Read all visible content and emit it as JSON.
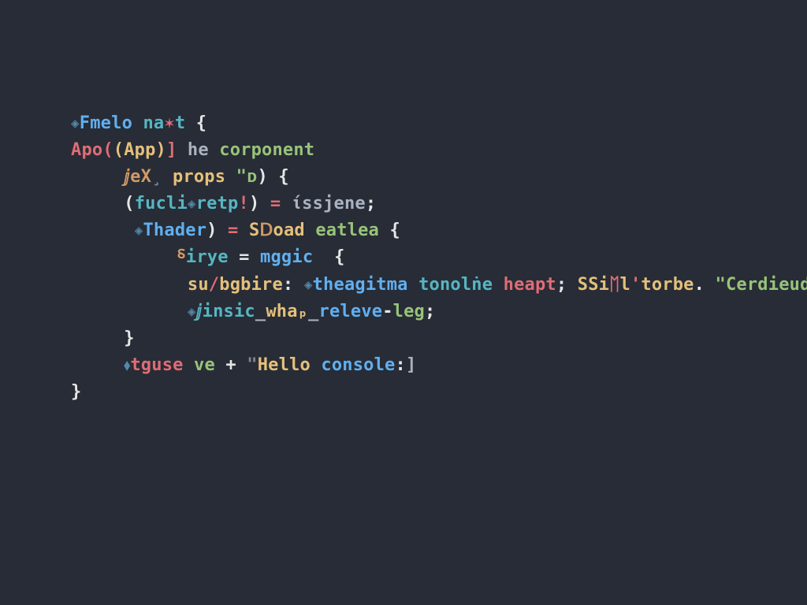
{
  "colors": {
    "background": "#272c36",
    "keyword": "#c678dd",
    "function": "#61afef",
    "string": "#98c379",
    "identifier": "#e5c07b",
    "red": "#e06c75",
    "cyan": "#56b6c2",
    "plain": "#abb2bf",
    "white": "#e6e6e6",
    "orange": "#d19a66"
  },
  "lines": [
    {
      "indent": 0,
      "tokens": [
        {
          "cls": "sym",
          "t": "◈"
        },
        {
          "cls": "fn",
          "t": "Fmelo "
        },
        {
          "cls": "cyan",
          "t": "na"
        },
        {
          "cls": "red",
          "t": "✶"
        },
        {
          "cls": "cyan",
          "t": "t "
        },
        {
          "cls": "white",
          "t": "{"
        }
      ]
    },
    {
      "indent": 0,
      "tokens": [
        {
          "cls": "red",
          "t": "Apo("
        },
        {
          "cls": "id",
          "t": "(App)"
        },
        {
          "cls": "red",
          "t": "]"
        },
        {
          "cls": "plain",
          "t": " he "
        },
        {
          "cls": "str",
          "t": "corponent"
        }
      ]
    },
    {
      "indent": 1,
      "tokens": [
        {
          "cls": "orange",
          "t": "ⅉeX"
        },
        {
          "cls": "dim",
          "t": "¸"
        },
        {
          "cls": "id",
          "t": " props "
        },
        {
          "cls": "str",
          "t": "\"ᴅ"
        },
        {
          "cls": "white",
          "t": ") {"
        }
      ]
    },
    {
      "indent": 1,
      "tokens": [
        {
          "cls": "white",
          "t": "("
        },
        {
          "cls": "cyan",
          "t": "fucli"
        },
        {
          "cls": "sym",
          "t": "◈"
        },
        {
          "cls": "cyan",
          "t": "retp"
        },
        {
          "cls": "red",
          "t": "!"
        },
        {
          "cls": "white",
          "t": ") "
        },
        {
          "cls": "red",
          "t": "= "
        },
        {
          "cls": "plain",
          "t": "ίssjene"
        },
        {
          "cls": "white",
          "t": ";"
        }
      ]
    },
    {
      "indent": 1,
      "tokens": [
        {
          "cls": "plain",
          "t": " "
        },
        {
          "cls": "sym",
          "t": "◈"
        },
        {
          "cls": "fn",
          "t": "Thader"
        },
        {
          "cls": "white",
          "t": ") "
        },
        {
          "cls": "red",
          "t": "= "
        },
        {
          "cls": "id",
          "t": "S"
        },
        {
          "cls": "orange",
          "t": "Ⅾ"
        },
        {
          "cls": "id",
          "t": "oad "
        },
        {
          "cls": "str",
          "t": "eatlea "
        },
        {
          "cls": "white",
          "t": "{"
        }
      ]
    },
    {
      "indent": 2,
      "tokens": [
        {
          "cls": "orange",
          "t": "⸹"
        },
        {
          "cls": "cyan",
          "t": "irye "
        },
        {
          "cls": "white",
          "t": "= "
        },
        {
          "cls": "fn",
          "t": "mggic"
        },
        {
          "cls": "white",
          "t": "  {"
        }
      ]
    },
    {
      "indent": 2,
      "tokens": [
        {
          "cls": "plain",
          "t": " "
        },
        {
          "cls": "id",
          "t": "su"
        },
        {
          "cls": "red",
          "t": "/"
        },
        {
          "cls": "id",
          "t": "bgbire"
        },
        {
          "cls": "white",
          "t": ": "
        },
        {
          "cls": "sym",
          "t": "◈"
        },
        {
          "cls": "fn",
          "t": "theagitma "
        },
        {
          "cls": "cyan",
          "t": "tonolṅe "
        },
        {
          "cls": "red",
          "t": "heapt"
        },
        {
          "cls": "white",
          "t": "; "
        },
        {
          "cls": "id",
          "t": "SSi"
        },
        {
          "cls": "red",
          "t": "ᛖ"
        },
        {
          "cls": "id",
          "t": "l"
        },
        {
          "cls": "red",
          "t": "'"
        },
        {
          "cls": "id",
          "t": "torbe"
        },
        {
          "cls": "white",
          "t": ". "
        },
        {
          "cls": "str",
          "t": "\"Cerdieuds,\""
        }
      ]
    },
    {
      "indent": 2,
      "tokens": [
        {
          "cls": "plain",
          "t": " "
        },
        {
          "cls": "sym",
          "t": "◈"
        },
        {
          "cls": "cyan",
          "t": "ⅉinsic"
        },
        {
          "cls": "plain",
          "t": "_"
        },
        {
          "cls": "id",
          "t": "whaₚ"
        },
        {
          "cls": "plain",
          "t": "_"
        },
        {
          "cls": "fn",
          "t": "releve"
        },
        {
          "cls": "white",
          "t": "-"
        },
        {
          "cls": "str",
          "t": "leg"
        },
        {
          "cls": "white",
          "t": ";"
        }
      ]
    },
    {
      "indent": 1,
      "tokens": [
        {
          "cls": "white",
          "t": "}"
        }
      ]
    },
    {
      "indent": 0,
      "tokens": [
        {
          "cls": "plain",
          "t": ""
        }
      ]
    },
    {
      "indent": 1,
      "tokens": [
        {
          "cls": "sym",
          "t": "⬧"
        },
        {
          "cls": "red",
          "t": "tguse "
        },
        {
          "cls": "str",
          "t": "ve "
        },
        {
          "cls": "white",
          "t": "+ "
        },
        {
          "cls": "dim",
          "t": "\""
        },
        {
          "cls": "id",
          "t": "Hello "
        },
        {
          "cls": "fn",
          "t": "console"
        },
        {
          "cls": "white",
          "t": ":"
        },
        {
          "cls": "plain",
          "t": "]"
        }
      ]
    },
    {
      "indent": 0,
      "tokens": [
        {
          "cls": "white",
          "t": "}"
        }
      ]
    }
  ],
  "indent_unit": "     "
}
